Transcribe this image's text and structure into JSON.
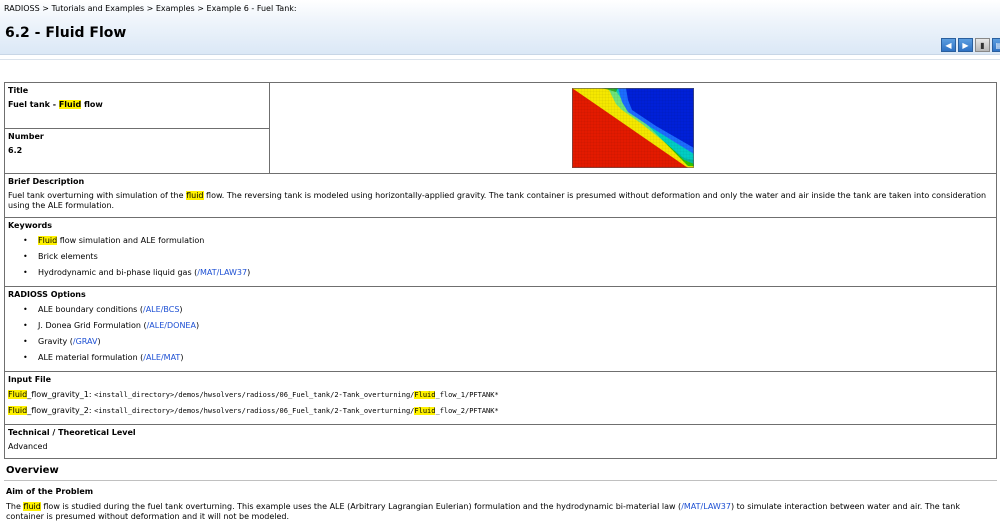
{
  "breadcrumb": "RADIOSS > Tutorials and Examples > Examples > Example 6 - Fuel Tank:",
  "page_title": "6.2 - Fluid Flow",
  "nav": {
    "prev": "◀",
    "next": "▶",
    "print": "▮",
    "toc": "▤"
  },
  "title_cell": {
    "label": "Title",
    "pre": "Fuel tank - ",
    "hl": "Fluid",
    "post": " flow"
  },
  "number_cell": {
    "label": "Number",
    "value": "6.2"
  },
  "brief": {
    "label": "Brief Description",
    "t1": "Fuel tank overturning with simulation of the ",
    "hl": "fluid",
    "t2": " flow. The reversing tank is modeled using horizontally-applied gravity. The tank container is presumed without deformation and only the water and air inside the tank are taken into consideration using the ALE formulation."
  },
  "keywords": {
    "label": "Keywords",
    "k1_hl": "Fluid",
    "k1_rest": " flow simulation and ALE formulation",
    "k2": "Brick elements",
    "k3_text": "Hydrodynamic and bi-phase liquid gas (",
    "k3_link": "/MAT/LAW37",
    "k3_close": ")"
  },
  "options": {
    "label": "RADIOSS Options",
    "items": [
      {
        "text": "ALE boundary conditions (",
        "link": "/ALE/BCS",
        "close": ")"
      },
      {
        "text": "J. Donea Grid Formulation (",
        "link": "/ALE/DONEA",
        "close": ")"
      },
      {
        "text": "Gravity (",
        "link": "/GRAV",
        "close": ")"
      },
      {
        "text": "ALE material formulation (",
        "link": "/ALE/MAT",
        "close": ")"
      }
    ]
  },
  "input_file": {
    "label": "Input File",
    "f1_hl": "Fluid",
    "f1_name": "_flow_gravity_1: ",
    "f1_path_a": "<install_directory>/demos/hwsolvers/radioss/06_Fuel_tank/2-Tank_overturning/",
    "f1_hl2": "Fluid",
    "f1_path_b": "_flow_1/PFTANK*",
    "f2_hl": "Fluid",
    "f2_name": "_flow_gravity_2: ",
    "f2_path_a": "<install_directory>/demos/hwsolvers/radioss/06_Fuel_tank/2-Tank_overturning/",
    "f2_hl2": "Fluid",
    "f2_path_b": "_flow_2/PFTANK*"
  },
  "level": {
    "label": "Technical / Theoretical Level",
    "value": "Advanced"
  },
  "overview": "Overview",
  "aim": {
    "label": "Aim of the Problem",
    "t1": "The ",
    "hl": "fluid",
    "t2": " flow is studied during the fuel tank overturning. This example uses the ALE (Arbitrary Lagrangian Eulerian) formulation and the hydrodynamic bi-material law (",
    "link": "/MAT/LAW37",
    "t3": ") to simulate interaction between water and air. The tank container is presumed without deformation and it will not be modeled."
  },
  "colors": {
    "highlight": "#fff200",
    "link": "#1c4fd3",
    "fluid": "#e31a00",
    "air": "#0020d8"
  }
}
